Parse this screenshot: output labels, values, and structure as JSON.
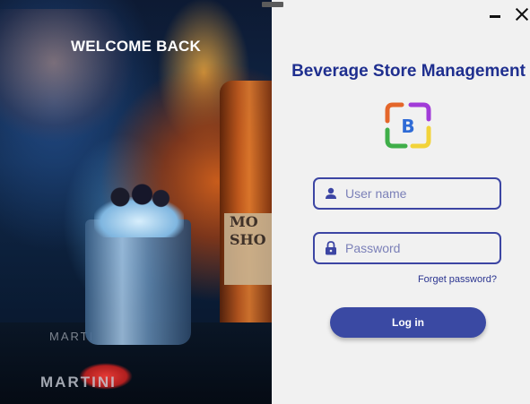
{
  "left_panel": {
    "welcome_text": "WELCOME BACK",
    "photo_texts": {
      "bottle_label_line1": "MO",
      "bottle_label_line2": "SHO",
      "mat_brand": "MARTINI",
      "mat_brand_top": "MARTI"
    }
  },
  "window": {
    "minimize_icon": "minimize-icon",
    "close_icon": "close-icon"
  },
  "app": {
    "title": "Beverage Store Management",
    "logo_letter": "B",
    "logo_colors": [
      "#e4662a",
      "#a13bd8",
      "#f2d33a",
      "#3fae49",
      "#2f6bd6"
    ]
  },
  "form": {
    "username": {
      "placeholder": "User name",
      "value": "",
      "icon": "user-icon"
    },
    "password": {
      "placeholder": "Password",
      "value": "",
      "icon": "lock-icon"
    },
    "forgot_label": "Forget password?",
    "login_label": "Log in"
  },
  "colors": {
    "accent": "#3a49a3",
    "title": "#1f2f8f",
    "background": "#f1f1f1"
  }
}
